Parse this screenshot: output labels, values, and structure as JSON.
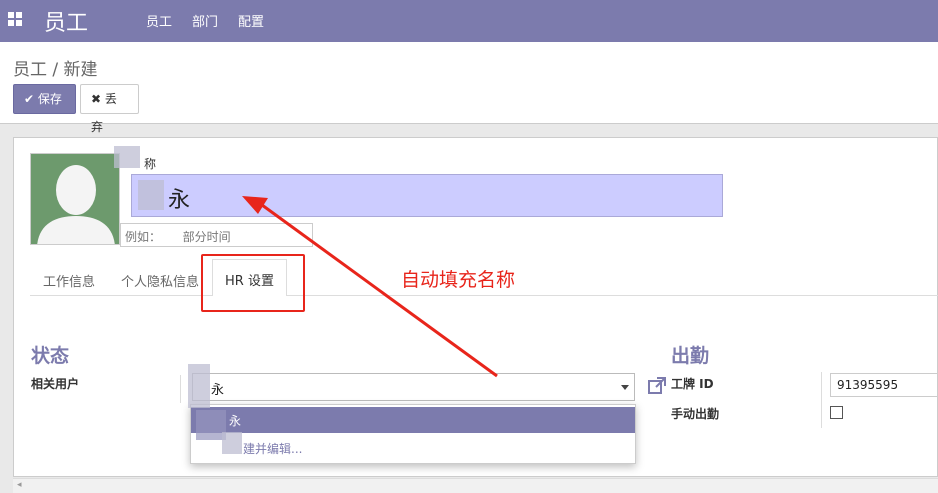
{
  "topbar": {
    "app_title": "员工",
    "menu": [
      "员工",
      "部门",
      "配置"
    ],
    "color": "#7c7bad"
  },
  "breadcrumb": {
    "parent": "员工",
    "separator": "/",
    "current": "新建"
  },
  "actions": {
    "save": {
      "icon": "check-icon",
      "label": "保存"
    },
    "discard": {
      "icon": "close-icon",
      "label": "丢弃"
    }
  },
  "form": {
    "avatar": "avatar-placeholder",
    "name_label": "称",
    "name_value": "永",
    "job_placeholder_prefix": "例如：",
    "job_placeholder_suffix": "部分时间"
  },
  "tabs": {
    "items": [
      "工作信息",
      "个人隐私信息",
      "HR 设置"
    ],
    "active": "HR 设置"
  },
  "annotation": {
    "text": "自动填充名称",
    "color": "#e8251b"
  },
  "status_section": {
    "title": "状态",
    "related_user_label": "相关用户",
    "related_user_value": "永",
    "dropdown": {
      "highlighted": "永",
      "create_edit": "建并编辑..."
    }
  },
  "attendance_section": {
    "title": "出勤",
    "badge_label": "工牌 ID",
    "badge_value": "91395595",
    "manual_label": "手动出勤",
    "manual_checked": false
  }
}
